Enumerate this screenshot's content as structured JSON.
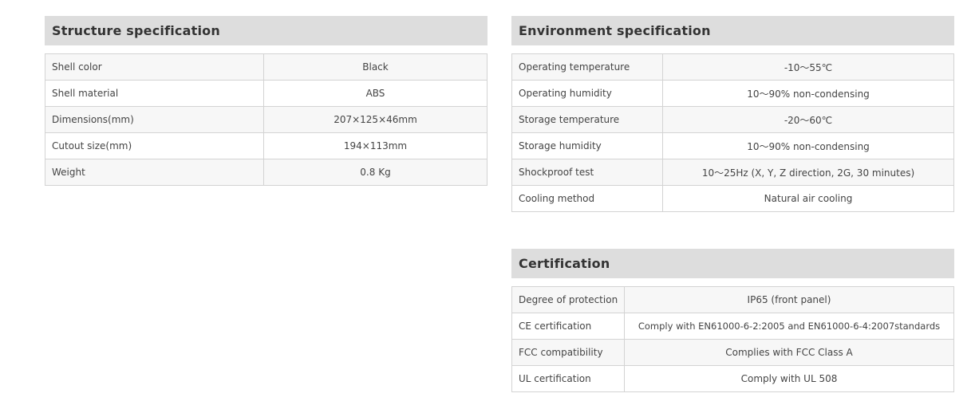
{
  "structure": {
    "title": "Structure specification",
    "rows": [
      {
        "label": "Shell color",
        "value": "Black"
      },
      {
        "label": "Shell material",
        "value": "ABS"
      },
      {
        "label": "Dimensions(mm)",
        "value": "207×125×46mm"
      },
      {
        "label": "Cutout size(mm)",
        "value": "194×113mm"
      },
      {
        "label": "Weight",
        "value": "0.8 Kg"
      }
    ]
  },
  "environment": {
    "title": "Environment specification",
    "rows": [
      {
        "label": "Operating temperature",
        "value": "-10～55℃"
      },
      {
        "label": "Operating humidity",
        "value": "10～90% non-condensing"
      },
      {
        "label": "Storage temperature",
        "value": "-20～60℃"
      },
      {
        "label": "Storage humidity",
        "value": "10～90% non-condensing"
      },
      {
        "label": "Shockproof test",
        "value": "10～25Hz (X, Y, Z direction, 2G, 30 minutes)"
      },
      {
        "label": "Cooling method",
        "value": "Natural air cooling"
      }
    ]
  },
  "certification": {
    "title": "Certification",
    "rows": [
      {
        "label": "Degree of protection",
        "value": "IP65 (front panel)"
      },
      {
        "label": "CE certification",
        "value": "Comply with EN61000-6-2:2005 and EN61000-6-4:2007standards"
      },
      {
        "label": "FCC compatibility",
        "value": "Complies with FCC Class A"
      },
      {
        "label": "UL certification",
        "value": "Comply with UL 508"
      }
    ]
  }
}
